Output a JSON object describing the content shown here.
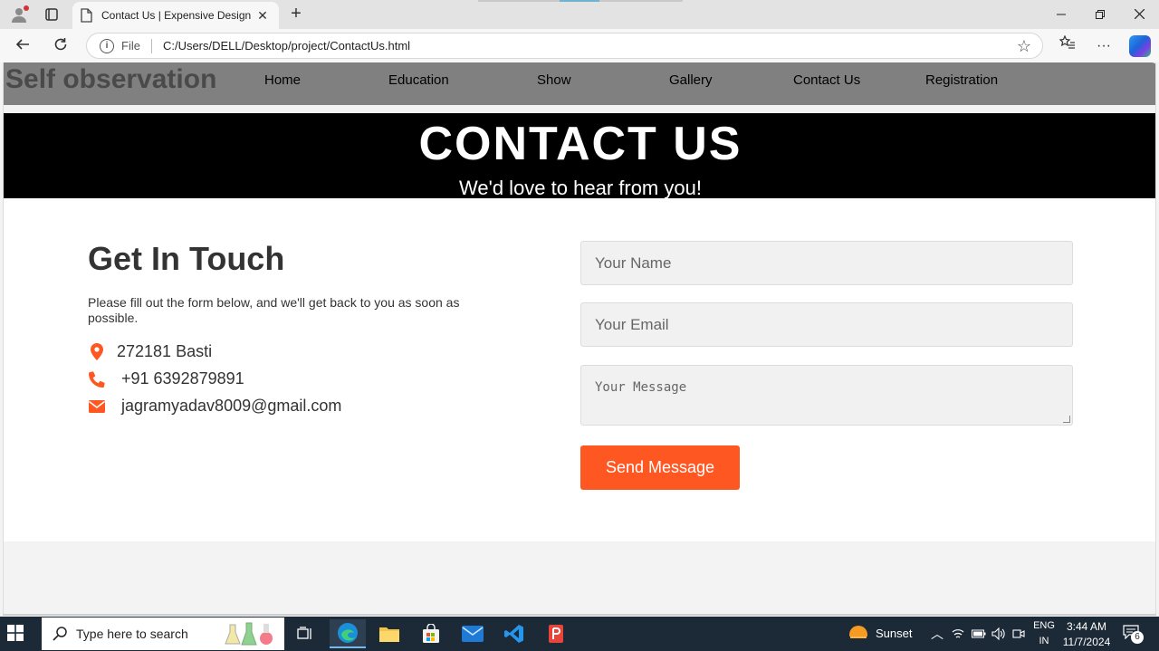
{
  "browser": {
    "tab_title": "Contact Us | Expensive Design",
    "tab_close": "✕",
    "new_tab": "+",
    "file_label": "File",
    "url": "C:/Users/DELL/Desktop/project/ContactUs.html",
    "more": "···"
  },
  "site": {
    "brand": "Self observation",
    "nav": [
      "Home",
      "Education",
      "Show",
      "Gallery",
      "Contact Us",
      "Registration"
    ]
  },
  "hero": {
    "title": "CONTACT US",
    "subtitle": "We'd love to hear from you!"
  },
  "contact": {
    "heading": "Get In Touch",
    "description": "Please fill out the form below, and we'll get back to you as soon as possible.",
    "address": "272181 Basti",
    "phone": "+91 6392879891",
    "email": "jagramyadav8009@gmail.com",
    "accent_color": "#ff5722"
  },
  "form": {
    "name_placeholder": "Your Name",
    "email_placeholder": "Your Email",
    "message_placeholder": "Your Message",
    "submit_label": "Send Message"
  },
  "taskbar": {
    "search_placeholder": "Type here to search",
    "weather": "Sunset",
    "lang_top": "ENG",
    "lang_bottom": "IN",
    "time": "3:44 AM",
    "date": "11/7/2024",
    "notifications": "6"
  }
}
